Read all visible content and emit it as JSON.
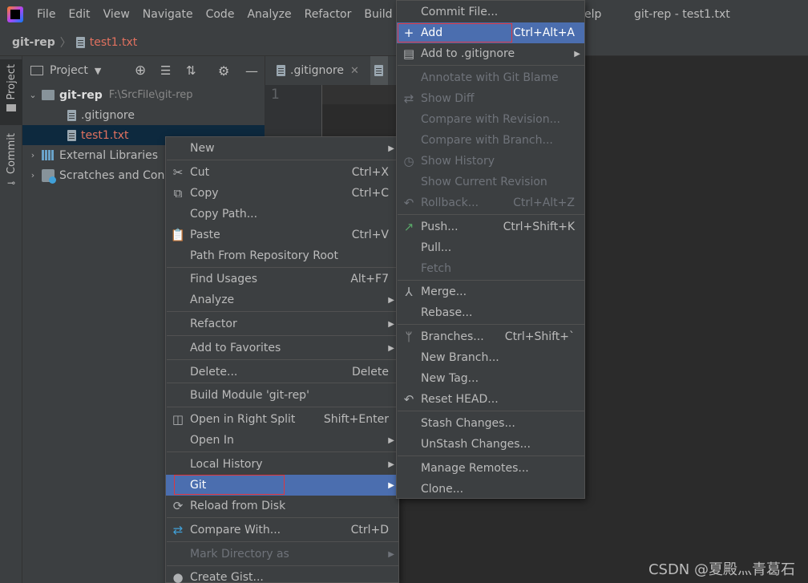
{
  "menubar": {
    "items": [
      "File",
      "Edit",
      "View",
      "Navigate",
      "Code",
      "Analyze",
      "Refactor",
      "Build"
    ],
    "help_fragment": "elp",
    "window_title": "git-rep - test1.txt"
  },
  "navbar": {
    "project": "git-rep",
    "file": "test1.txt"
  },
  "sidebar": {
    "project_tab": "Project",
    "commit_tab": "Commit"
  },
  "project_panel": {
    "title": "Project",
    "tree": [
      {
        "label": "git-rep",
        "detail": "F:\\SrcFile\\git-rep"
      },
      {
        "label": ".gitignore"
      },
      {
        "label": "test1.txt"
      },
      {
        "label": "External Libraries"
      },
      {
        "label": "Scratches and Con"
      }
    ]
  },
  "editor": {
    "tab": ".gitignore",
    "line_number": "1"
  },
  "context_menu": {
    "items": [
      {
        "label": "New",
        "shortcut": ""
      },
      {
        "label": "Cut",
        "shortcut": "Ctrl+X"
      },
      {
        "label": "Copy",
        "shortcut": "Ctrl+C"
      },
      {
        "label": "Copy Path...",
        "shortcut": ""
      },
      {
        "label": "Paste",
        "shortcut": "Ctrl+V"
      },
      {
        "label": "Path From Repository Root",
        "shortcut": ""
      },
      {
        "label": "Find Usages",
        "shortcut": "Alt+F7"
      },
      {
        "label": "Analyze",
        "shortcut": ""
      },
      {
        "label": "Refactor",
        "shortcut": ""
      },
      {
        "label": "Add to Favorites",
        "shortcut": ""
      },
      {
        "label": "Delete...",
        "shortcut": "Delete"
      },
      {
        "label": "Build Module 'git-rep'",
        "shortcut": ""
      },
      {
        "label": "Open in Right Split",
        "shortcut": "Shift+Enter"
      },
      {
        "label": "Open In",
        "shortcut": ""
      },
      {
        "label": "Local History",
        "shortcut": ""
      },
      {
        "label": "Git",
        "shortcut": ""
      },
      {
        "label": "Reload from Disk",
        "shortcut": ""
      },
      {
        "label": "Compare With...",
        "shortcut": "Ctrl+D"
      },
      {
        "label": "Mark Directory as",
        "shortcut": ""
      },
      {
        "label": "Create Gist...",
        "shortcut": ""
      }
    ]
  },
  "git_menu": {
    "items": [
      {
        "label": "Commit File...",
        "shortcut": ""
      },
      {
        "label": "Add",
        "shortcut": "Ctrl+Alt+A"
      },
      {
        "label": "Add to .gitignore",
        "shortcut": ""
      },
      {
        "label": "Annotate with Git Blame",
        "shortcut": ""
      },
      {
        "label": "Show Diff",
        "shortcut": ""
      },
      {
        "label": "Compare with Revision...",
        "shortcut": ""
      },
      {
        "label": "Compare with Branch...",
        "shortcut": ""
      },
      {
        "label": "Show History",
        "shortcut": ""
      },
      {
        "label": "Show Current Revision",
        "shortcut": ""
      },
      {
        "label": "Rollback...",
        "shortcut": "Ctrl+Alt+Z"
      },
      {
        "label": "Push...",
        "shortcut": "Ctrl+Shift+K"
      },
      {
        "label": "Pull...",
        "shortcut": ""
      },
      {
        "label": "Fetch",
        "shortcut": ""
      },
      {
        "label": "Merge...",
        "shortcut": ""
      },
      {
        "label": "Rebase...",
        "shortcut": ""
      },
      {
        "label": "Branches...",
        "shortcut": "Ctrl+Shift+`"
      },
      {
        "label": "New Branch...",
        "shortcut": ""
      },
      {
        "label": "New Tag...",
        "shortcut": ""
      },
      {
        "label": "Reset HEAD...",
        "shortcut": ""
      },
      {
        "label": "Stash Changes...",
        "shortcut": ""
      },
      {
        "label": "UnStash Changes...",
        "shortcut": ""
      },
      {
        "label": "Manage Remotes...",
        "shortcut": ""
      },
      {
        "label": "Clone...",
        "shortcut": ""
      }
    ]
  },
  "watermark": "CSDN @夏殿灬青葛石",
  "colors": {
    "highlight": "#4b6eaf",
    "annotation_box": "#e0363d",
    "panel": "#3c3f41",
    "editor": "#2b2b2b"
  }
}
